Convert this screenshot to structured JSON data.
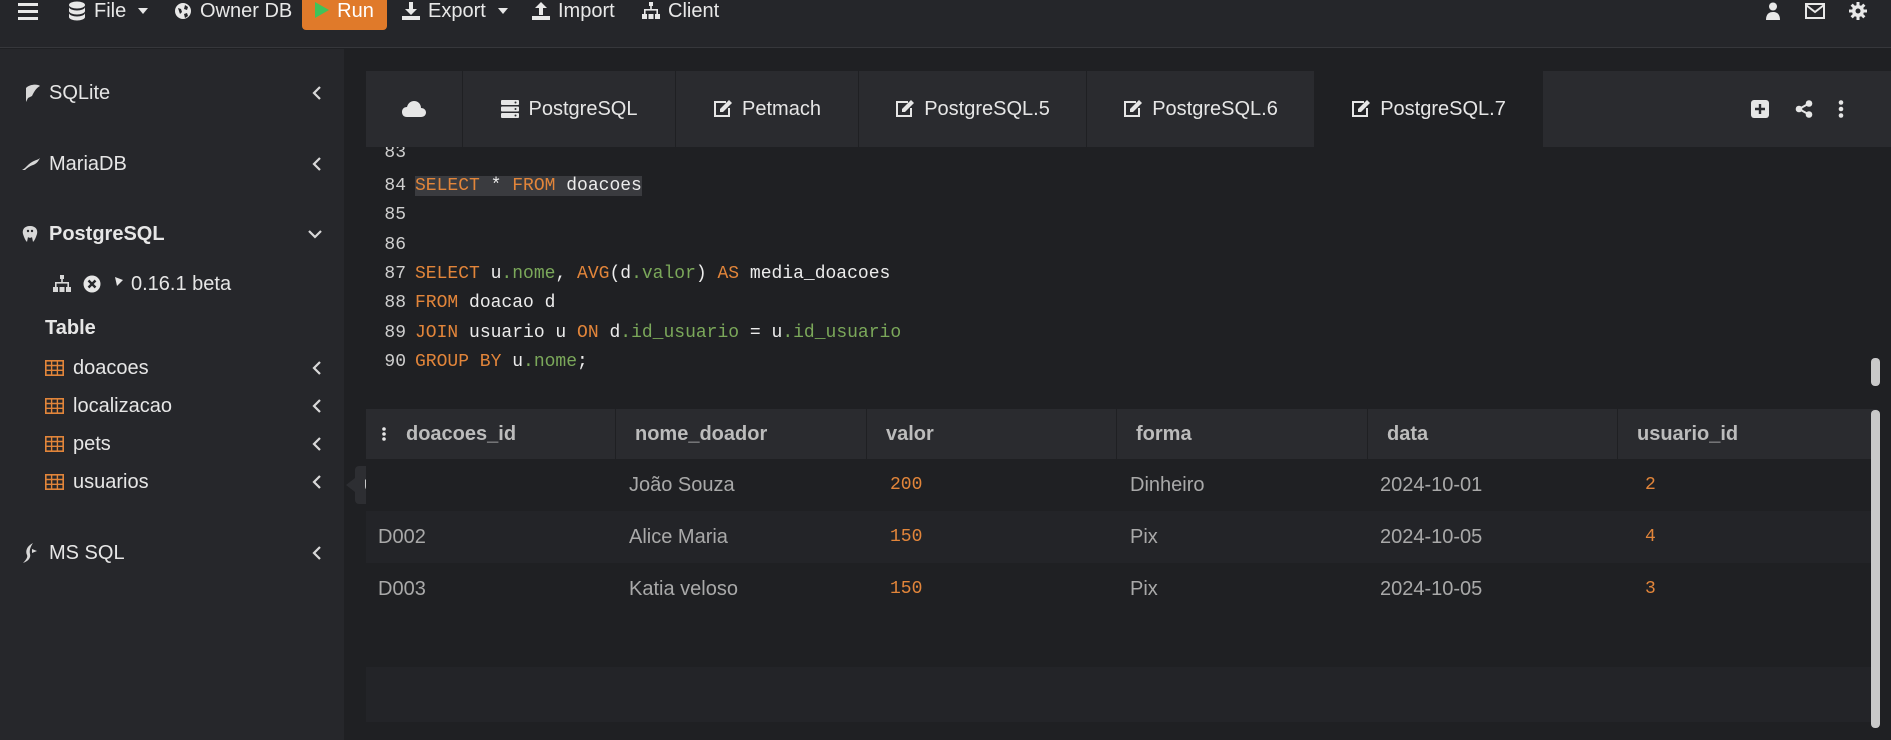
{
  "topbar": {
    "file": "File",
    "owner_db": "Owner DB",
    "run": "Run",
    "export": "Export",
    "import": "Import",
    "client": "Client"
  },
  "sidebar": {
    "sqlite": "SQLite",
    "mariadb": "MariaDB",
    "postgresql": "PostgreSQL",
    "version": "0.16.1 beta",
    "table_heading": "Table",
    "tables": [
      "doacoes",
      "localizacao",
      "pets",
      "usuarios"
    ],
    "mssql": "MS SQL",
    "tooltip": "usuarios"
  },
  "tabs": [
    "PostgreSQL",
    "Petmach",
    "PostgreSQL.5",
    "PostgreSQL.6",
    "PostgreSQL.7"
  ],
  "editor": {
    "line_numbers": [
      "83",
      "84",
      "85",
      "86",
      "87",
      "88",
      "89",
      "90"
    ],
    "l84": [
      "SELECT",
      " * ",
      "FROM",
      " doacoes"
    ],
    "l87": [
      "SELECT",
      " u",
      ".nome",
      ", ",
      "AVG",
      "(d",
      ".valor",
      ") ",
      "AS",
      " media_doacoes"
    ],
    "l88": [
      "FROM",
      " doacao d"
    ],
    "l89": [
      "JOIN",
      " usuario u ",
      "ON",
      " d",
      ".id_usuario",
      " = u",
      ".id_usuario"
    ],
    "l90": [
      "GROUP BY",
      " u",
      ".nome",
      ";"
    ]
  },
  "results": {
    "columns": [
      "doacoes_id",
      "nome_doador",
      "valor",
      "forma",
      "data",
      "usuario_id"
    ],
    "rows": [
      [
        "",
        "João Souza",
        "200",
        "Dinheiro",
        "2024-10-01",
        "2"
      ],
      [
        "D002",
        "Alice Maria",
        "150",
        "Pix",
        "2024-10-05",
        "4"
      ],
      [
        "D003",
        "Katia veloso",
        "150",
        "Pix",
        "2024-10-05",
        "3"
      ]
    ]
  },
  "colors": {
    "accent": "#e07a2a",
    "keyword": "#e2853a",
    "column_ref": "#7ba85a"
  }
}
